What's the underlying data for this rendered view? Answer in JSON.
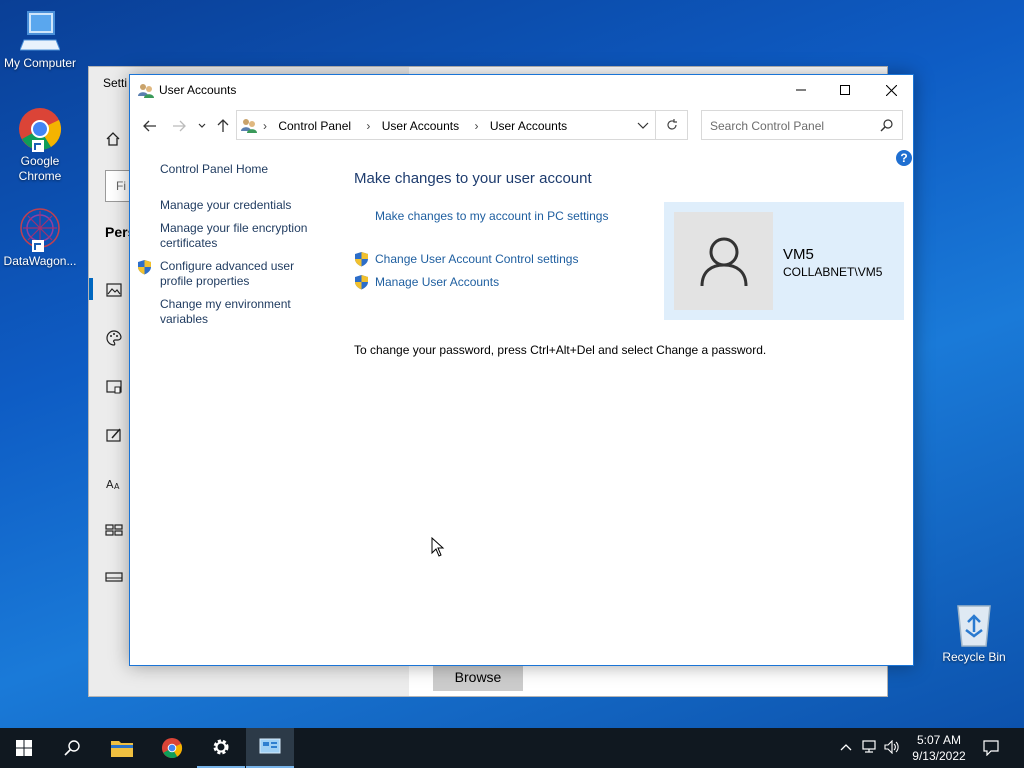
{
  "desktop": {
    "icons": [
      {
        "label": "My Computer"
      },
      {
        "label": "Google Chrome"
      },
      {
        "label": "DataWagon..."
      },
      {
        "label": "Recycle Bin"
      }
    ]
  },
  "settings_window": {
    "title": "Setti",
    "search_placeholder": "Fi",
    "section": "Pers",
    "browse_label": "Browse"
  },
  "user_accounts_window": {
    "title": "User Accounts",
    "breadcrumb": [
      "Control Panel",
      "User Accounts",
      "User Accounts"
    ],
    "search_placeholder": "Search Control Panel",
    "help": "?",
    "left_nav": [
      {
        "label_line1": "Control Panel Home",
        "label_line2": ""
      },
      {
        "label_line1": "Manage your credentials",
        "label_line2": ""
      },
      {
        "label_line1": "Manage your file encryption",
        "label_line2": "certificates"
      },
      {
        "label_line1": "Configure advanced user",
        "label_line2": "profile properties"
      },
      {
        "label_line1": "Change my environment",
        "label_line2": "variables"
      }
    ],
    "heading": "Make changes to your user account",
    "links": [
      "Make changes to my account in PC settings",
      "Change User Account Control settings",
      "Manage User Accounts"
    ],
    "info": "To change your password, press Ctrl+Alt+Del and select Change a password.",
    "user": {
      "name": "VM5",
      "domain": "COLLABNET\\VM5"
    }
  },
  "taskbar": {
    "time": "5:07 AM",
    "date": "9/13/2022"
  },
  "colors": {
    "accent": "#0067c0",
    "link": "#1f5fa0",
    "heading": "#1e3c6e",
    "user_card": "#dfeefb"
  }
}
